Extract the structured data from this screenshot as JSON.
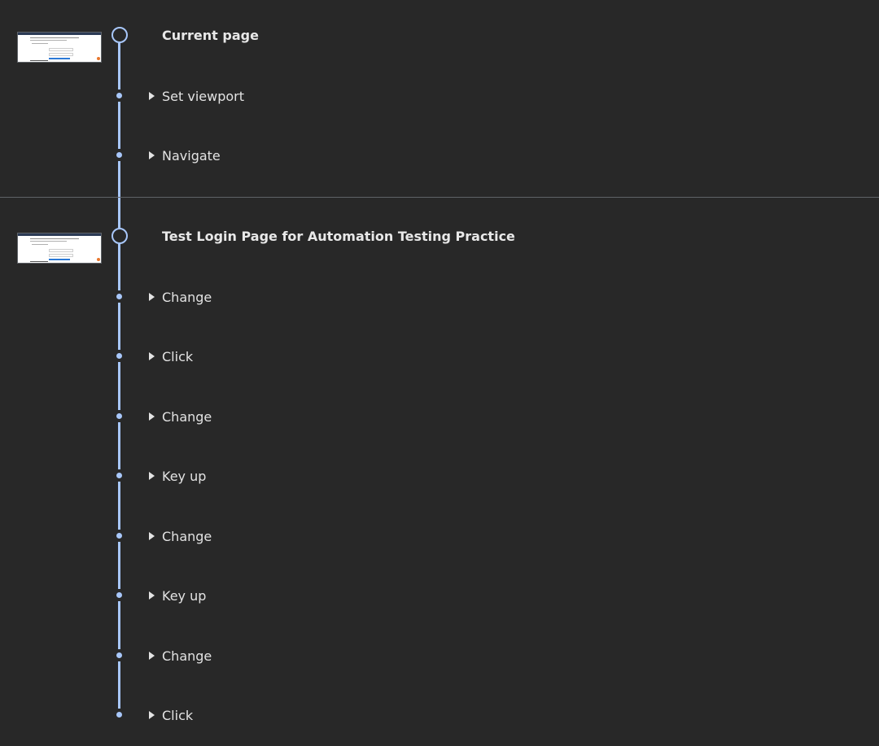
{
  "colors": {
    "background": "#282828",
    "timeline": "#a8c7fa",
    "text": "#e3e3e3",
    "divider": "#5f6368"
  },
  "sections": [
    {
      "title": "Current page",
      "thumbnail_icon": "page-screenshot-thumbnail",
      "steps": [
        {
          "label": "Set viewport"
        },
        {
          "label": "Navigate"
        }
      ]
    },
    {
      "title": "Test Login Page for Automation Testing Practice",
      "thumbnail_icon": "page-screenshot-thumbnail",
      "steps": [
        {
          "label": "Change"
        },
        {
          "label": "Click"
        },
        {
          "label": "Change"
        },
        {
          "label": "Key up"
        },
        {
          "label": "Change"
        },
        {
          "label": "Key up"
        },
        {
          "label": "Change"
        },
        {
          "label": "Click"
        }
      ]
    }
  ]
}
